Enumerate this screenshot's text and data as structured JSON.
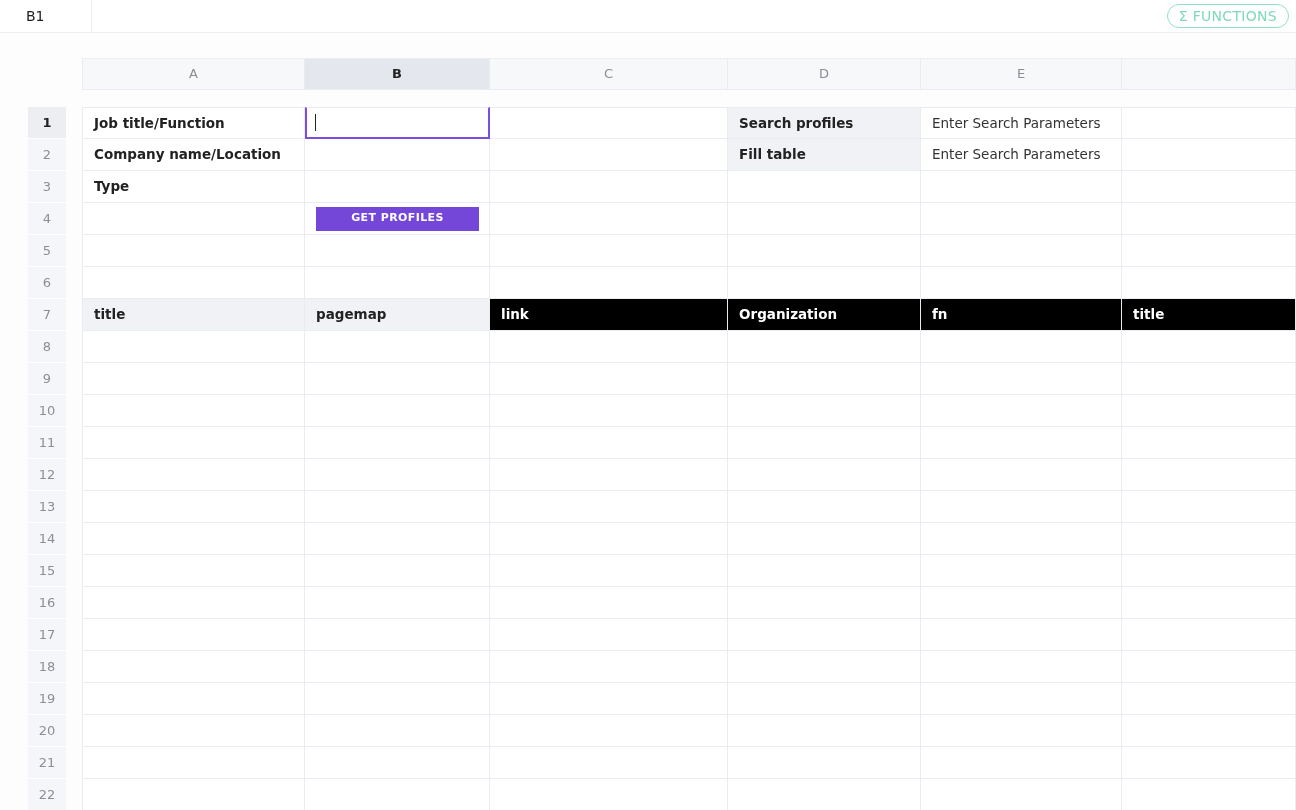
{
  "formula_bar": {
    "cell_ref": "B1",
    "functions_button": "Σ FUNCTIONS"
  },
  "columns": [
    {
      "label": "A",
      "selected": false
    },
    {
      "label": "B",
      "selected": true
    },
    {
      "label": "C",
      "selected": false
    },
    {
      "label": "D",
      "selected": false
    },
    {
      "label": "E",
      "selected": false
    },
    {
      "selected": false
    }
  ],
  "rows": [
    {
      "number": "1",
      "selected": true,
      "cells": [
        {
          "kind": "label",
          "text": "Job title/Function"
        },
        {
          "kind": "input",
          "selected": true
        },
        {
          "kind": "empty"
        },
        {
          "kind": "shaded-label",
          "text": "Search profiles"
        },
        {
          "kind": "text",
          "text": "Enter Search Parameters"
        },
        {
          "kind": "empty"
        }
      ]
    },
    {
      "number": "2",
      "selected": false,
      "cells": [
        {
          "kind": "label",
          "text": "Company name/Location"
        },
        {
          "kind": "empty"
        },
        {
          "kind": "empty"
        },
        {
          "kind": "shaded-label",
          "text": "Fill table"
        },
        {
          "kind": "text",
          "text": "Enter Search Parameters"
        },
        {
          "kind": "empty"
        }
      ]
    },
    {
      "number": "3",
      "selected": false,
      "cells": [
        {
          "kind": "label",
          "text": "Type"
        },
        {
          "kind": "empty"
        },
        {
          "kind": "empty"
        },
        {
          "kind": "empty"
        },
        {
          "kind": "empty"
        },
        {
          "kind": "empty"
        }
      ]
    },
    {
      "number": "4",
      "selected": false,
      "cells": [
        {
          "kind": "empty"
        },
        {
          "kind": "button",
          "text": "GET PROFILES"
        },
        {
          "kind": "empty"
        },
        {
          "kind": "empty"
        },
        {
          "kind": "empty"
        },
        {
          "kind": "empty"
        }
      ]
    },
    {
      "number": "5",
      "selected": false
    },
    {
      "number": "6",
      "selected": false
    },
    {
      "number": "7",
      "selected": false,
      "cells": [
        {
          "kind": "shaded-label",
          "text": "title"
        },
        {
          "kind": "shaded-label",
          "text": "pagemap"
        },
        {
          "kind": "dark-label",
          "text": "link"
        },
        {
          "kind": "dark-label",
          "text": "Organization"
        },
        {
          "kind": "dark-label",
          "text": "fn"
        },
        {
          "kind": "dark-label",
          "text": "title"
        }
      ]
    },
    {
      "number": "8",
      "selected": false
    },
    {
      "number": "9",
      "selected": false
    },
    {
      "number": "10",
      "selected": false
    },
    {
      "number": "11",
      "selected": false
    },
    {
      "number": "12",
      "selected": false
    },
    {
      "number": "13",
      "selected": false
    },
    {
      "number": "14",
      "selected": false
    },
    {
      "number": "15",
      "selected": false
    },
    {
      "number": "16",
      "selected": false
    },
    {
      "number": "17",
      "selected": false
    },
    {
      "number": "18",
      "selected": false
    },
    {
      "number": "19",
      "selected": false
    },
    {
      "number": "20",
      "selected": false
    },
    {
      "number": "21",
      "selected": false
    },
    {
      "number": "22",
      "selected": false
    }
  ]
}
